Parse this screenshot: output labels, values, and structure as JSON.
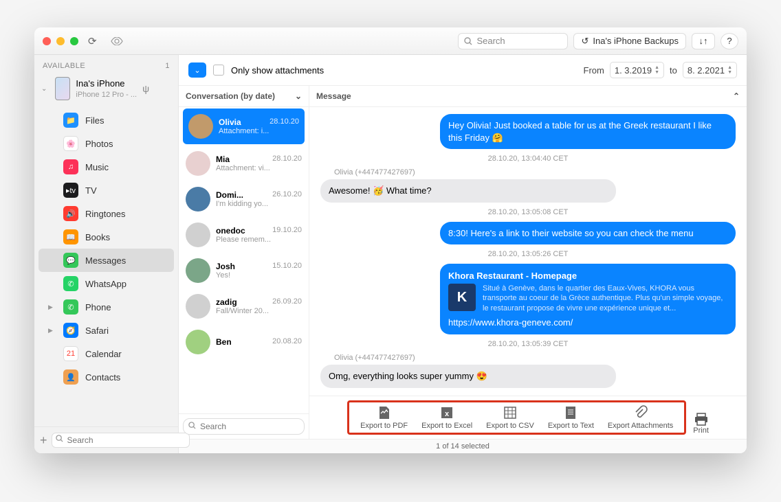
{
  "toolbar": {
    "search_placeholder": "Search",
    "backups_label": "Ina's iPhone Backups",
    "help_label": "?"
  },
  "sidebar": {
    "header": "AVAILABLE",
    "count": "1",
    "device_name": "Ina's iPhone",
    "device_model": "iPhone 12 Pro - ...",
    "categories": [
      {
        "label": "Files",
        "color": "#1e90ff",
        "icon": "folder",
        "expandable": false
      },
      {
        "label": "Photos",
        "color": "#ffffff",
        "icon": "photos",
        "expandable": false
      },
      {
        "label": "Music",
        "color": "#fc3158",
        "icon": "music",
        "expandable": false
      },
      {
        "label": "TV",
        "color": "#1c1c1e",
        "icon": "tv",
        "expandable": false
      },
      {
        "label": "Ringtones",
        "color": "#ff3b30",
        "icon": "ringtone",
        "expandable": false
      },
      {
        "label": "Books",
        "color": "#ff9500",
        "icon": "book",
        "expandable": false
      },
      {
        "label": "Messages",
        "color": "#34c759",
        "icon": "message",
        "expandable": false,
        "selected": true
      },
      {
        "label": "WhatsApp",
        "color": "#25d366",
        "icon": "whatsapp",
        "expandable": false
      },
      {
        "label": "Phone",
        "color": "#34c759",
        "icon": "phone",
        "expandable": true
      },
      {
        "label": "Safari",
        "color": "#007aff",
        "icon": "safari",
        "expandable": true
      },
      {
        "label": "Calendar",
        "color": "#ffffff",
        "icon": "calendar",
        "expandable": false
      },
      {
        "label": "Contacts",
        "color": "#f0a050",
        "icon": "contacts",
        "expandable": false
      }
    ],
    "search_placeholder": "Search"
  },
  "filter": {
    "only_attachments": "Only show attachments",
    "from": "From",
    "date_start": "1.  3.2019",
    "to": "to",
    "date_end": "8.  2.2021"
  },
  "conv_header": "Conversation (by date)",
  "msg_header": "Message",
  "conversations": [
    {
      "name": "Olivia",
      "date": "28.10.20",
      "sub": "Attachment: i...",
      "selected": true,
      "avatar": "#c19a6b"
    },
    {
      "name": "Mia",
      "date": "28.10.20",
      "sub": "Attachment: vi...",
      "avatar": "#e8d0d0"
    },
    {
      "name": "Domi...",
      "date": "26.10.20",
      "sub": "I'm kidding yo...",
      "avatar": "#4a7ba6"
    },
    {
      "name": "onedoc",
      "date": "19.10.20",
      "sub": "Please remem...",
      "avatar": "#d0d0d0"
    },
    {
      "name": "Josh",
      "date": "15.10.20",
      "sub": "Yes!",
      "avatar": "#7ba688"
    },
    {
      "name": "zadig",
      "date": "26.09.20",
      "sub": "Fall/Winter 20...",
      "avatar": "#d0d0d0"
    },
    {
      "name": "Ben",
      "date": "20.08.20",
      "sub": "",
      "avatar": "#a0d080"
    }
  ],
  "conv_search_placeholder": "Search",
  "messages": {
    "sender_label": "Olivia (+447477427697)",
    "items": [
      {
        "kind": "out",
        "text": "Hey Olivia! Just booked a table for us at the Greek restaurant I like this Friday 🤗"
      },
      {
        "kind": "ts",
        "text": "28.10.20, 13:04:40 CET"
      },
      {
        "kind": "sender"
      },
      {
        "kind": "in",
        "text": "Awesome! 🥳 What time?"
      },
      {
        "kind": "ts",
        "text": "28.10.20, 13:05:08 CET"
      },
      {
        "kind": "out",
        "text": "8:30! Here's a link to their website so you can check the menu"
      },
      {
        "kind": "ts",
        "text": "28.10.20, 13:05:26 CET"
      },
      {
        "kind": "link",
        "title": "Khora Restaurant - Homepage",
        "desc": "Situé à Genève, dans le quartier des Eaux-Vives, KHORA vous transporte au coeur de la Grèce authentique. Plus qu'un simple voyage, le restaurant propose de vivre une expérience unique et...",
        "url": "https://www.khora-geneve.com/",
        "thumb": "K"
      },
      {
        "kind": "ts",
        "text": "28.10.20, 13:05:39 CET"
      },
      {
        "kind": "sender"
      },
      {
        "kind": "in",
        "text": "Omg, everything looks super yummy 😍"
      }
    ]
  },
  "export": [
    {
      "label": "Export to PDF",
      "icon": "pdf"
    },
    {
      "label": "Export to Excel",
      "icon": "excel"
    },
    {
      "label": "Export to CSV",
      "icon": "csv"
    },
    {
      "label": "Export to Text",
      "icon": "text"
    },
    {
      "label": "Export Attachments",
      "icon": "attach"
    }
  ],
  "print_label": "Print",
  "status": "1 of 14 selected"
}
